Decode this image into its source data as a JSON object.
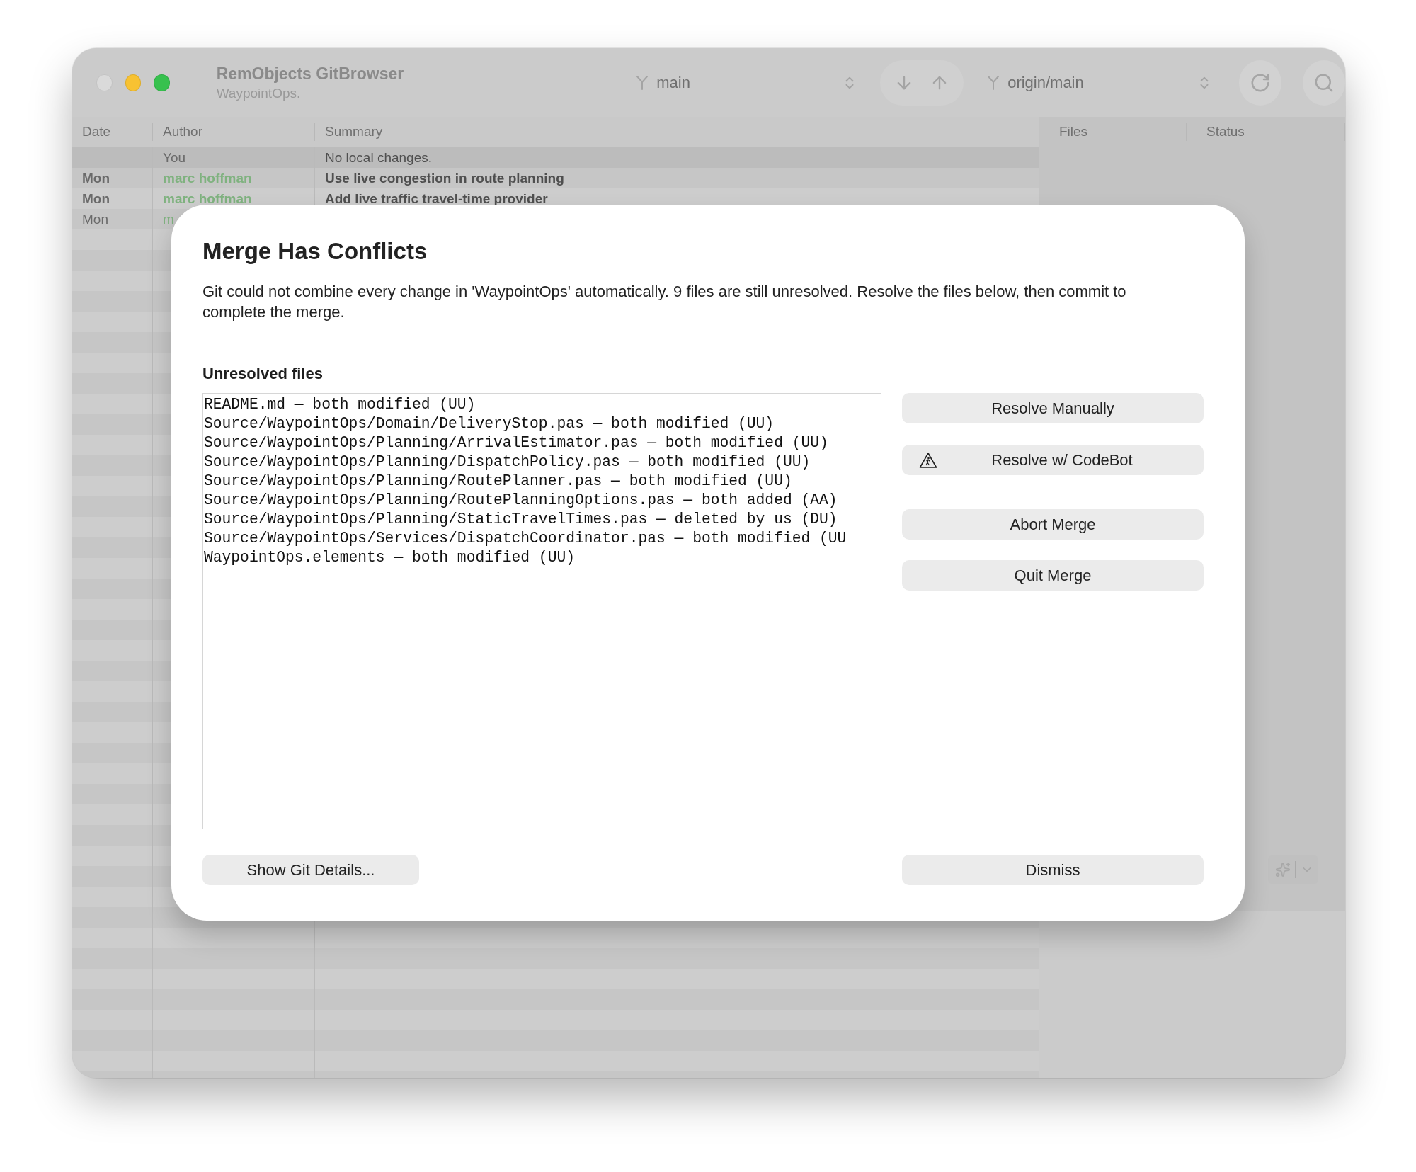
{
  "window": {
    "title": "RemObjects GitBrowser",
    "subtitle": "WaypointOps."
  },
  "toolbar": {
    "local_branch": "main",
    "remote_branch": "origin/main"
  },
  "table": {
    "columns": [
      "Date",
      "Author",
      "Summary"
    ],
    "rows": [
      {
        "author": "You",
        "summary": "No local changes.",
        "selected": true,
        "emphasized": false
      },
      {
        "date": "Mon",
        "author": "marc hoffman",
        "summary": "Use live congestion in route planning",
        "selected": false,
        "emphasized": true
      },
      {
        "date": "Mon",
        "author": "marc hoffman",
        "summary": "Add live traffic travel-time provider",
        "selected": false,
        "emphasized": true
      },
      {
        "date": "Mon",
        "author": "m",
        "selected": false,
        "emphasized": false
      }
    ]
  },
  "details_panel": {
    "columns": [
      "Files",
      "Status"
    ]
  },
  "dialog": {
    "title": "Merge Has Conflicts",
    "message": "Git could not combine every change in 'WaypointOps' automatically. 9 files are still unresolved. Resolve the files below, then commit to complete the merge.",
    "list_label": "Unresolved files",
    "files": [
      "README.md — both modified (UU)",
      "Source/WaypointOps/Domain/DeliveryStop.pas — both modified (UU)",
      "Source/WaypointOps/Planning/ArrivalEstimator.pas — both modified (UU)",
      "Source/WaypointOps/Planning/DispatchPolicy.pas — both modified (UU)",
      "Source/WaypointOps/Planning/RoutePlanner.pas — both modified (UU)",
      "Source/WaypointOps/Planning/RoutePlanningOptions.pas — both added (AA)",
      "Source/WaypointOps/Planning/StaticTravelTimes.pas — deleted by us (DU)",
      "Source/WaypointOps/Services/DispatchCoordinator.pas — both modified (UU",
      "WaypointOps.elements — both modified (UU)"
    ],
    "side_buttons": [
      {
        "label": "Resolve Manually",
        "kind": "plain"
      },
      {
        "label": "Resolve w/ CodeBot",
        "kind": "codebot"
      },
      {
        "label": "Abort Merge",
        "kind": "plain"
      },
      {
        "label": "Quit Merge",
        "kind": "plain"
      }
    ],
    "details_button": "Show Git Details...",
    "dismiss_button": "Dismiss"
  }
}
